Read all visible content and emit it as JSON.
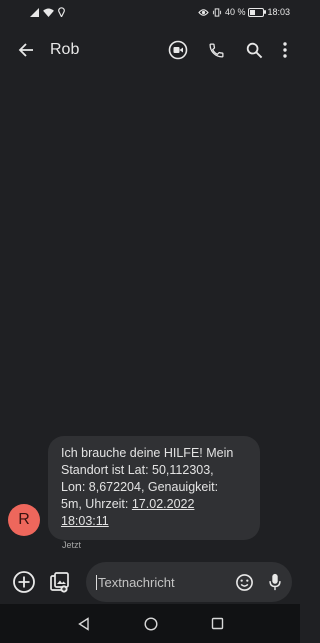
{
  "status_bar": {
    "battery": "40 %",
    "battery_level": 0.4,
    "time": "18:03"
  },
  "app_bar": {
    "contact_name": "Rob"
  },
  "message": {
    "line1": "Ich brauche deine HILFE! Mein",
    "line2": "Standort ist Lat: 50,112303,",
    "line3": "Lon: 8,672204, Genauigkeit:",
    "line4_prefix": "5m, Uhrzeit: ",
    "line4_link": "17.02.2022",
    "line5_link": "18:03:11",
    "avatar_letter": "R",
    "timestamp": "Jetzt"
  },
  "compose": {
    "placeholder": "Textnachricht"
  },
  "colors": {
    "background": "#1f2023",
    "bubble": "#303134",
    "avatar": "#ee675c"
  }
}
